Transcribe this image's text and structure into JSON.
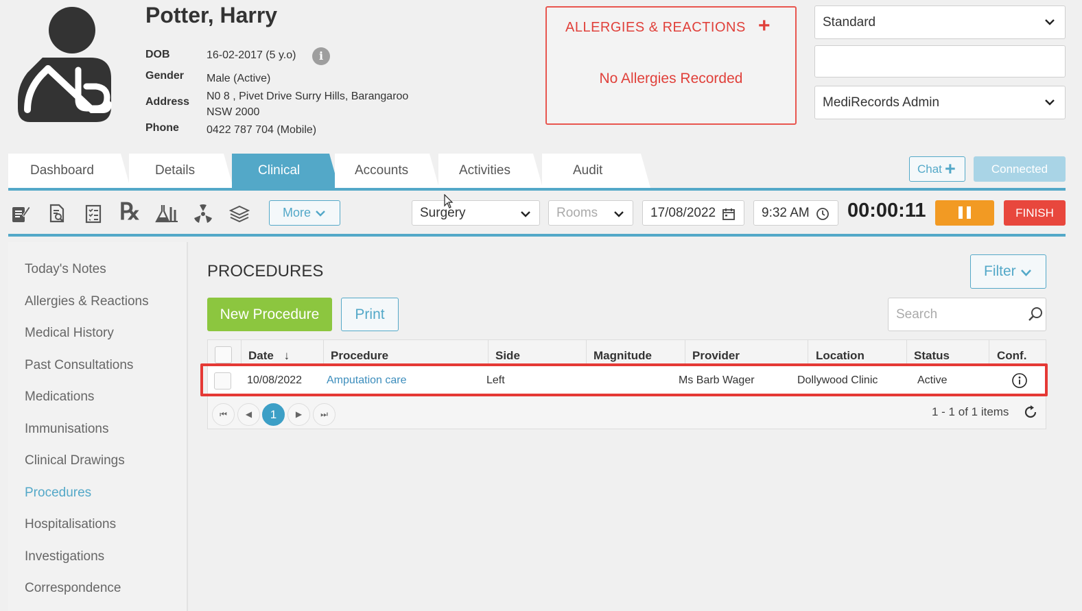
{
  "patient": {
    "name": "Potter, Harry",
    "dob_label": "DOB",
    "dob_value": "16-02-2017 (5 y.o)",
    "gender_label": "Gender",
    "gender_value": "Male (Active)",
    "address_label": "Address",
    "address_line1": "N0 8 , Pivet Drive Surry Hills, Barangaroo",
    "address_line2": "NSW 2000",
    "phone_label": "Phone",
    "phone_value": "0422 787 704 (Mobile)"
  },
  "allergies": {
    "title": "ALLERGIES & REACTIONS",
    "add_icon": "+",
    "empty_text": "No Allergies Recorded"
  },
  "selectors": {
    "mode": "Standard",
    "blank_field": "",
    "user": "MediRecords Admin"
  },
  "tabs": [
    {
      "label": "Dashboard"
    },
    {
      "label": "Details"
    },
    {
      "label": "Clinical"
    },
    {
      "label": "Accounts"
    },
    {
      "label": "Activities"
    },
    {
      "label": "Audit"
    }
  ],
  "chat": {
    "label": "Chat",
    "plus": "+"
  },
  "connection_status": "Connected",
  "toolbar": {
    "icons": [
      "notes-icon",
      "document-search-icon",
      "checklist-icon",
      "prescription-icon",
      "lab-flask-icon",
      "radiology-icon",
      "layers-icon"
    ],
    "rx_glyph": "℞",
    "more_label": "More",
    "location": "Surgery",
    "rooms_placeholder": "Rooms",
    "date": "17/08/2022",
    "time": "9:32 AM",
    "timer": "00:00:11",
    "finish_label": "FINISH"
  },
  "sidenav": {
    "items": [
      {
        "label": "Today's Notes"
      },
      {
        "label": "Allergies & Reactions"
      },
      {
        "label": "Medical History"
      },
      {
        "label": "Past Consultations"
      },
      {
        "label": "Medications"
      },
      {
        "label": "Immunisations"
      },
      {
        "label": "Clinical Drawings"
      },
      {
        "label": "Procedures"
      },
      {
        "label": "Hospitalisations"
      },
      {
        "label": "Investigations"
      },
      {
        "label": "Correspondence"
      }
    ],
    "active_index": 7
  },
  "procedures": {
    "title": "PROCEDURES",
    "filter_label": "Filter",
    "new_label": "New Procedure",
    "print_label": "Print",
    "search_placeholder": "Search",
    "columns": [
      "Date",
      "Procedure",
      "Side",
      "Magnitude",
      "Provider",
      "Location",
      "Status",
      "Conf."
    ],
    "sort_indicator": "↓",
    "rows": [
      {
        "date": "10/08/2022",
        "procedure": "Amputation care",
        "side": "Left",
        "magnitude": "",
        "provider": "Ms Barb Wager",
        "location": "Dollywood Clinic",
        "status": "Active"
      }
    ],
    "pager": {
      "first": "⏮",
      "prev": "◀",
      "page": "1",
      "next": "▶",
      "last": "⏭",
      "info": "1 - 1 of 1 items"
    }
  },
  "colors": {
    "accent": "#53a8c8",
    "alert": "#e0403a",
    "new_button": "#8cc63f",
    "pause": "#f29a23",
    "finish": "#e8473d",
    "highlight": "#e53935"
  }
}
